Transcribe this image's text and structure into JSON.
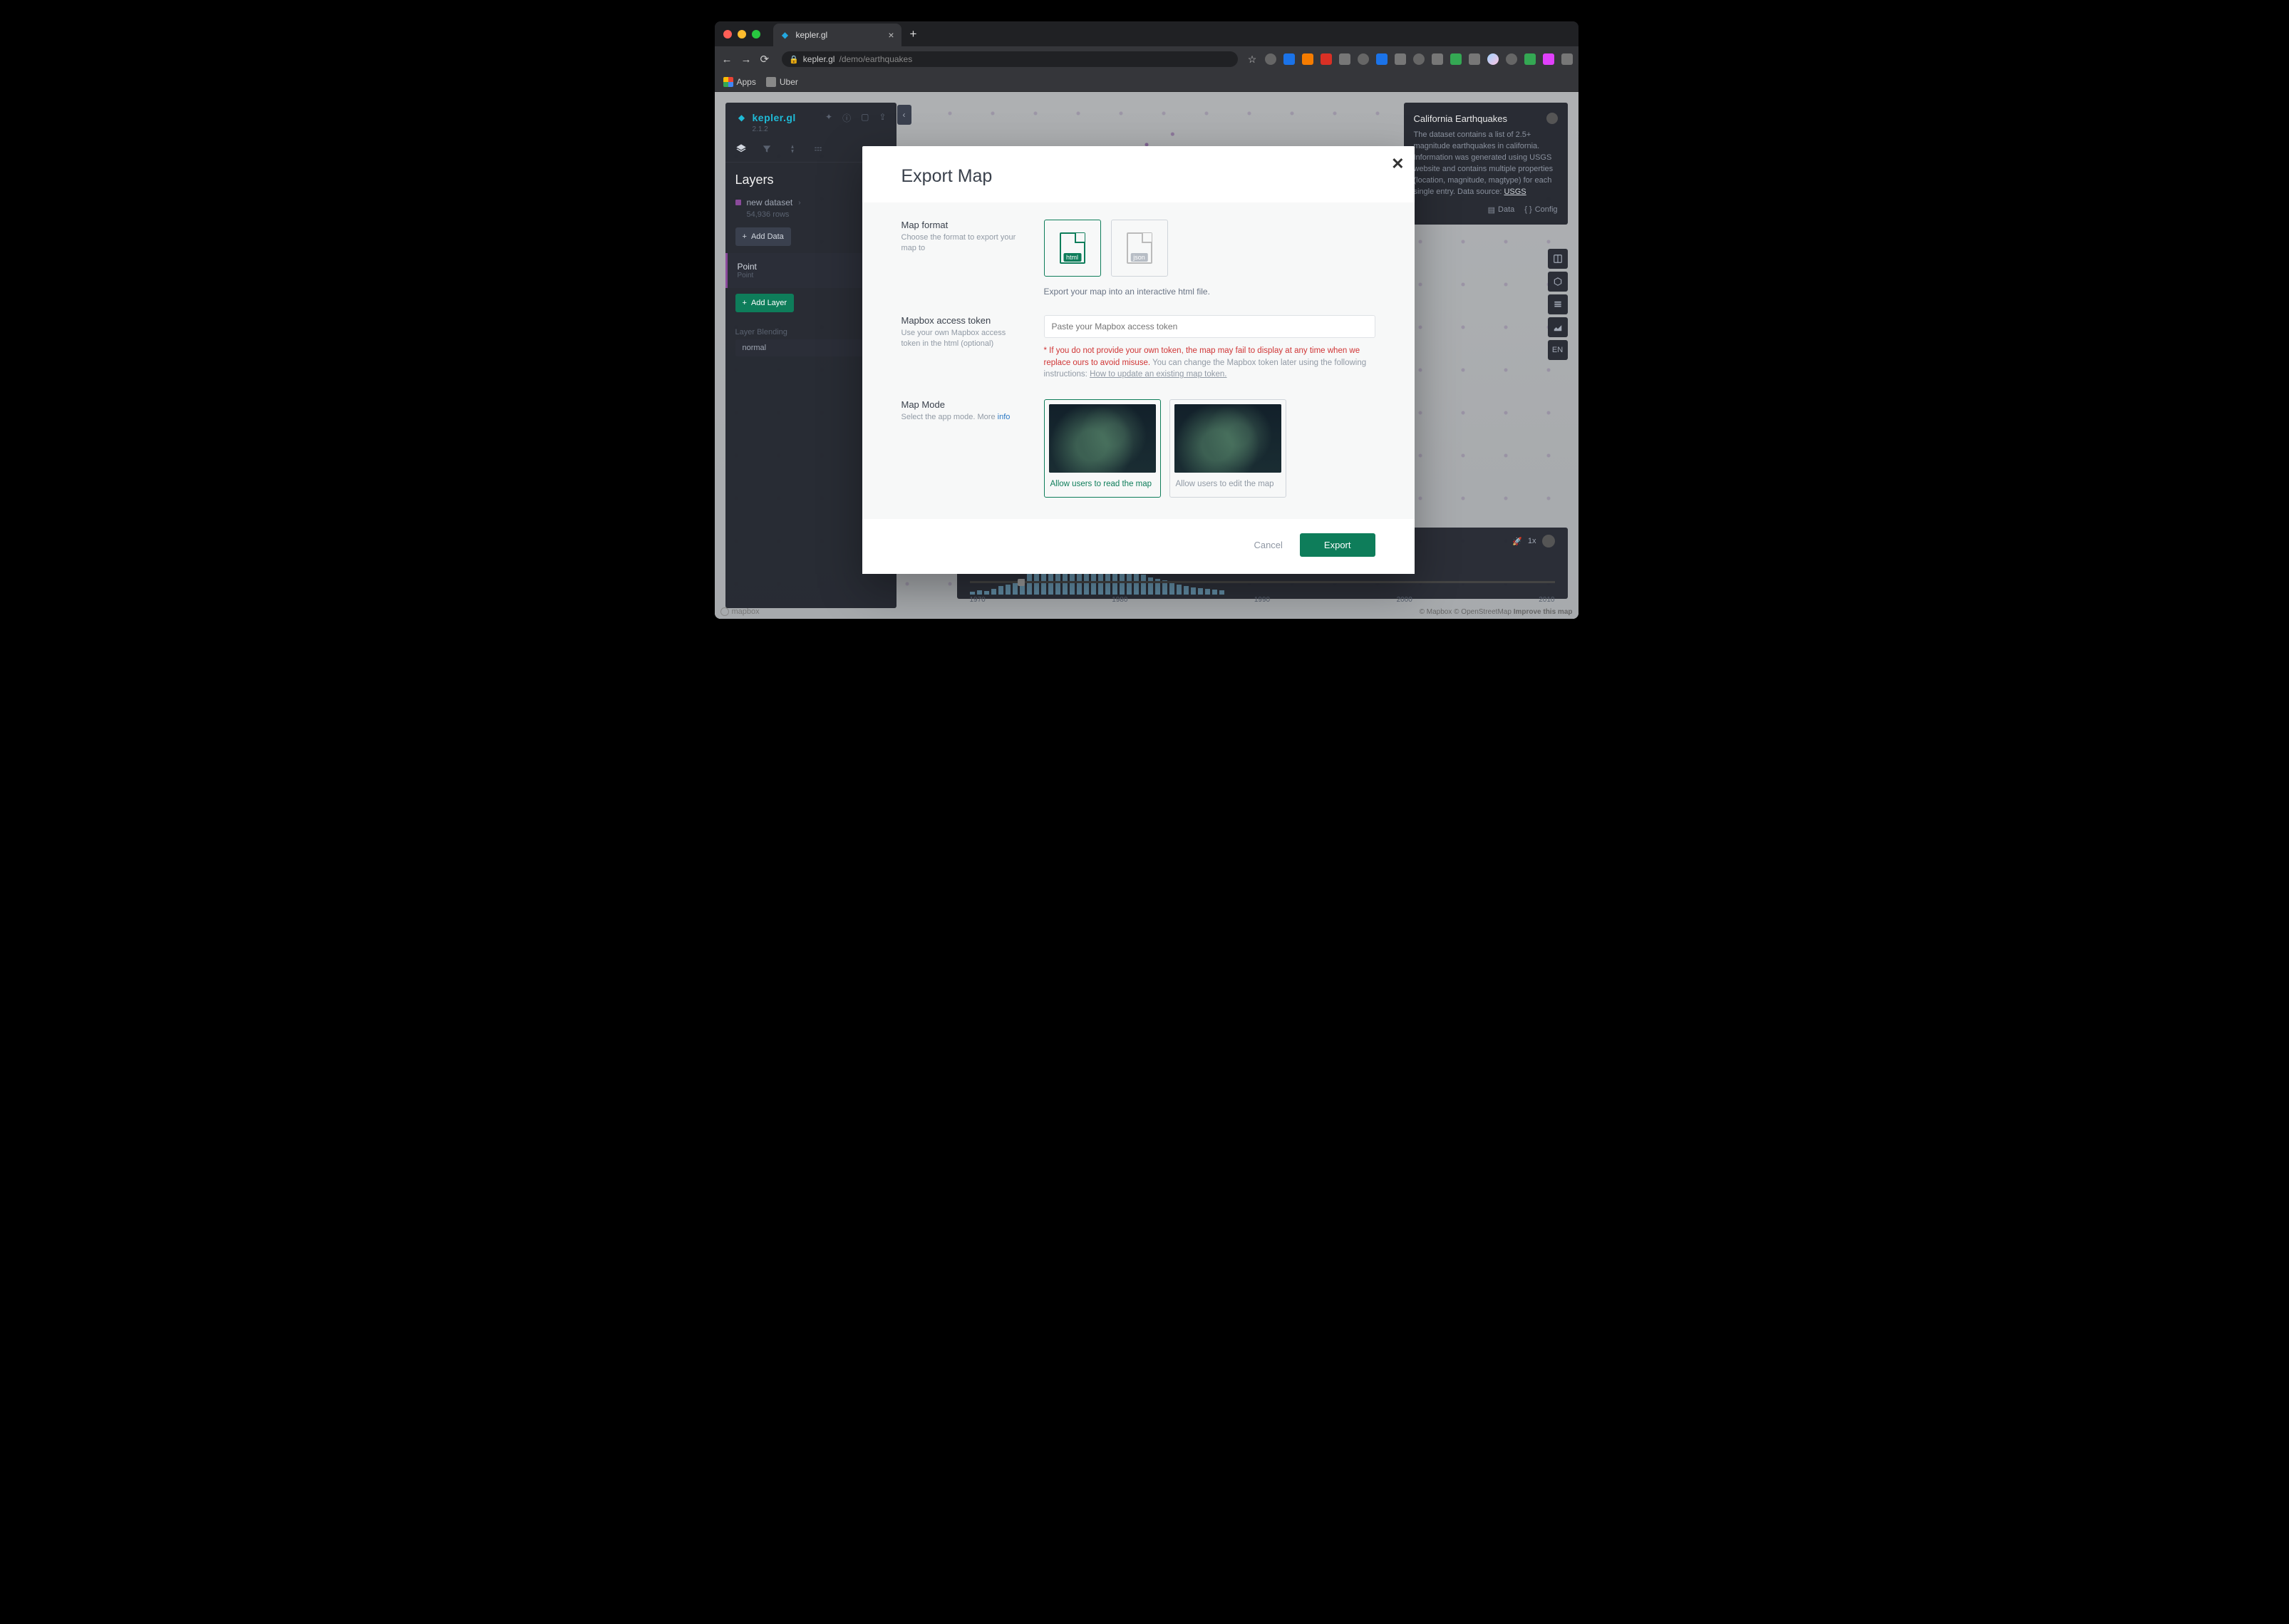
{
  "browser": {
    "tab_title": "kepler.gl",
    "url_host": "kepler.gl",
    "url_path": "/demo/earthquakes",
    "bookmarks": {
      "apps": "Apps",
      "uber": "Uber"
    }
  },
  "app": {
    "logo": "kepler.gl",
    "version": "2.1.2",
    "section_title": "Layers",
    "dataset": {
      "name": "new dataset",
      "rows": "54,936 rows"
    },
    "add_data": "Add Data",
    "layer": {
      "name": "Point",
      "type": "Point"
    },
    "add_layer": "Add Layer",
    "blend_label": "Layer Blending",
    "blend_value": "normal"
  },
  "info": {
    "title": "California Earthquakes",
    "body_pre": "The dataset contains a list of 2.5+ magnitude earthquakes in california. Information was generated using USGS website and contains multiple properties (location, magnitude, magtype) for each single entry. Data source: ",
    "source": "USGS",
    "data_btn": "Data",
    "config_btn": "Config"
  },
  "tools": {
    "en": "EN"
  },
  "timeline": {
    "speed": "1x",
    "ticks": [
      "1970",
      "1980",
      "1990",
      "2000",
      "2010"
    ],
    "bars": [
      4,
      6,
      5,
      8,
      12,
      14,
      18,
      22,
      30,
      34,
      40,
      35,
      30,
      42,
      48,
      55,
      60,
      62,
      58,
      52,
      48,
      40,
      38,
      32,
      28,
      24,
      22,
      20,
      18,
      14,
      12,
      10,
      9,
      8,
      7,
      6
    ]
  },
  "attrib": {
    "mapbox": "© Mapbox",
    "osm": "© OpenStreetMap",
    "improve": "Improve this map",
    "logo": "mapbox"
  },
  "modal": {
    "title": "Export Map",
    "close": "✕",
    "format": {
      "label": "Map format",
      "desc": "Choose the format to export your map to",
      "html": "html",
      "json": "json",
      "export_desc": "Export your map into an interactive html file."
    },
    "token": {
      "label": "Mapbox access token",
      "desc": "Use your own Mapbox access token in the html (optional)",
      "placeholder": "Paste your Mapbox access token",
      "warn_red": "* If you do not provide your own token, the map may fail to display at any time when we replace ours to avoid misuse.",
      "warn_grey": " You can change the Mapbox token later using the following instructions: ",
      "warn_link": "How to update an existing map token."
    },
    "mode": {
      "label": "Map Mode",
      "desc_pre": "Select the app mode. More ",
      "desc_link": "info",
      "read": "Allow users to read the map",
      "edit": "Allow users to edit the map"
    },
    "footer": {
      "cancel": "Cancel",
      "export": "Export"
    }
  }
}
